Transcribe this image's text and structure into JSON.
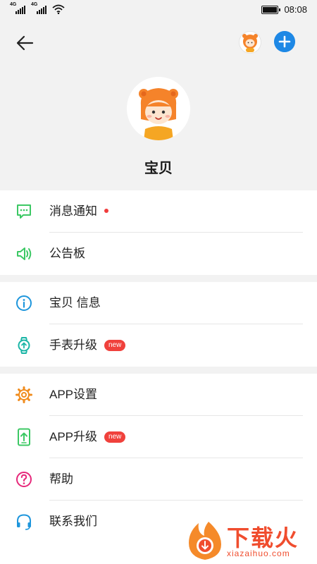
{
  "status_bar": {
    "signal1_label": "4G",
    "signal2_label": "4G",
    "wifi_icon": "wifi-icon",
    "battery_icon": "battery-icon",
    "time": "08:08"
  },
  "header": {
    "back_icon": "back-arrow-icon",
    "add_icon": "plus-circle-icon",
    "name": "宝贝"
  },
  "menu": {
    "messages_label": "消息通知",
    "bulletin_label": "公告板",
    "baby_info_label": "宝贝 信息",
    "watch_upgrade_label": "手表升级",
    "watch_upgrade_badge": "new",
    "app_settings_label": "APP设置",
    "app_upgrade_label": "APP升级",
    "app_upgrade_badge": "new",
    "help_label": "帮助",
    "contact_label": "联系我们"
  },
  "watermark": {
    "text": "下载火",
    "url": "xiazaihuo.com"
  },
  "colors": {
    "accent_blue": "#1e88e5",
    "green": "#3cc864",
    "blue_icon": "#1e96dc",
    "teal": "#1ab5a6",
    "orange": "#f08c1e",
    "magenta": "#e6287a",
    "badge_red": "#f0413c"
  }
}
